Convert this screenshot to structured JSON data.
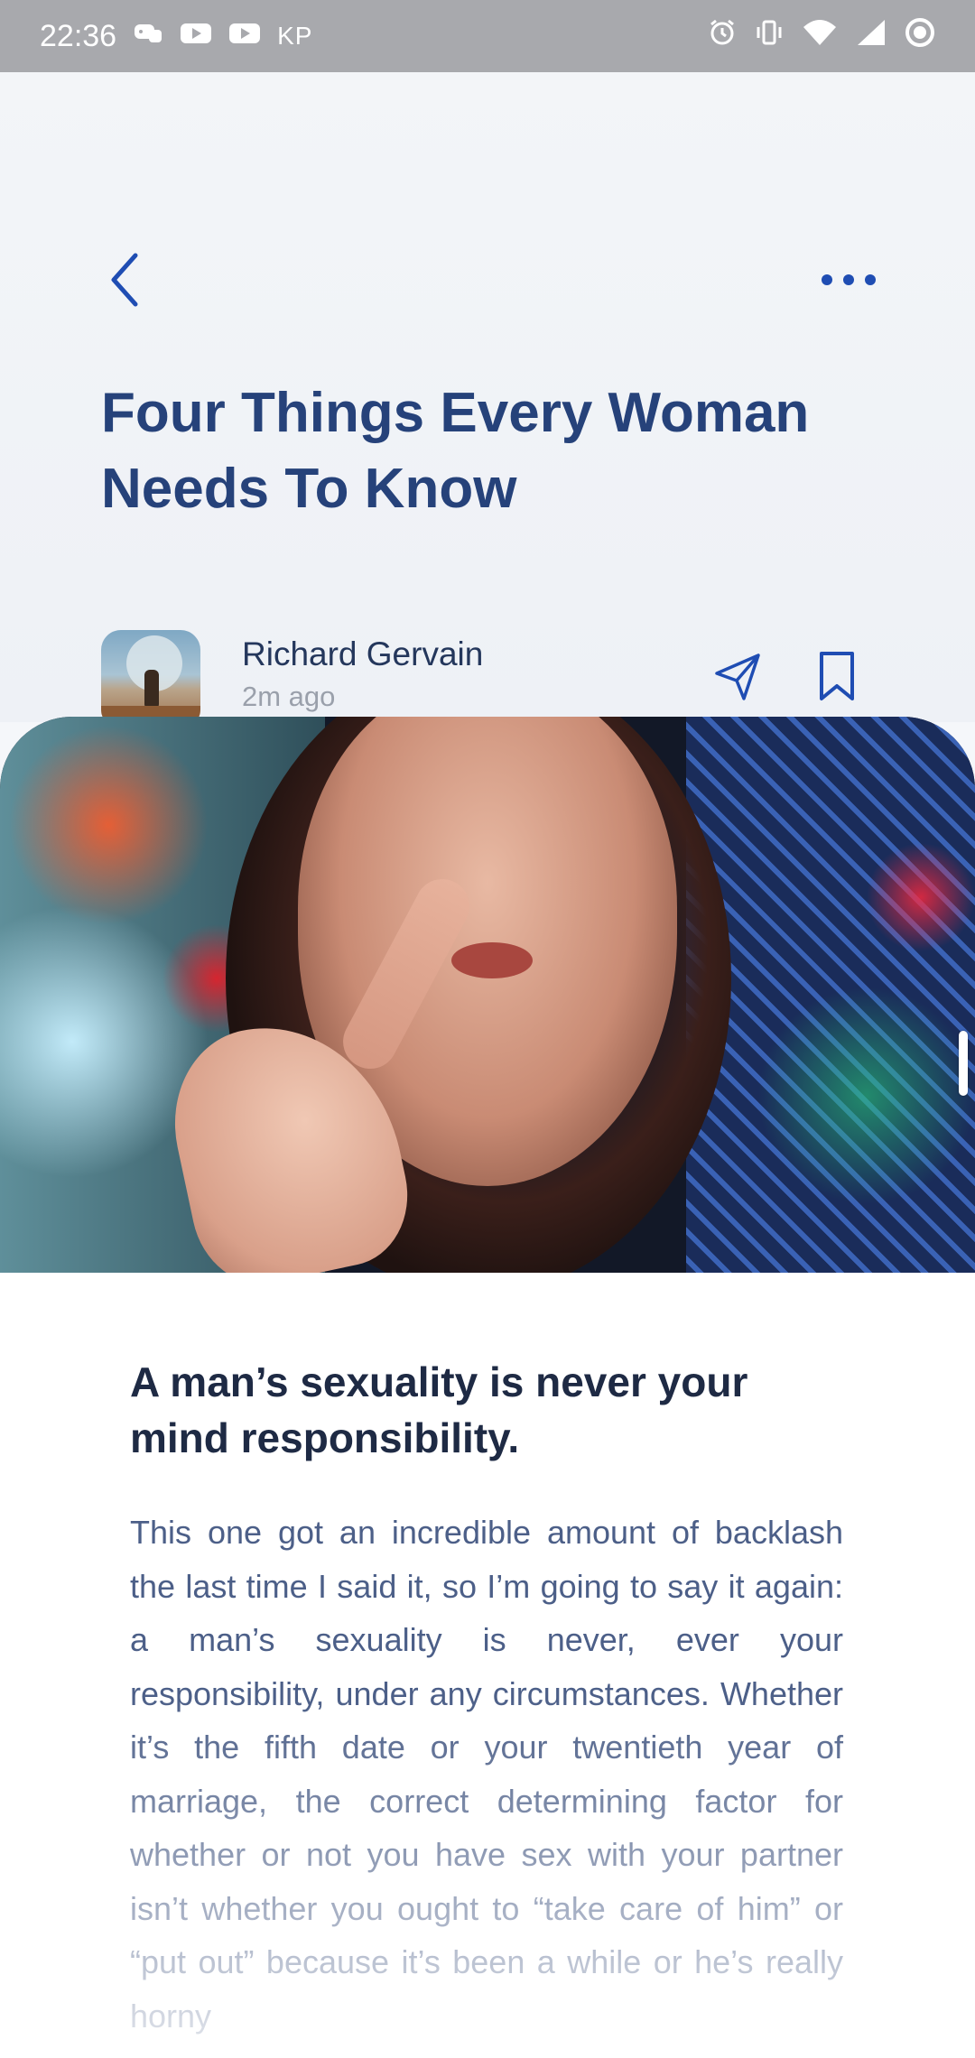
{
  "status_bar": {
    "time": "22:36",
    "carrier": "KP",
    "left_icons": [
      "game-controller-icon",
      "youtube-icon",
      "youtube-icon"
    ],
    "right_icons": [
      "alarm-icon",
      "vibrate-icon",
      "wifi-icon",
      "signal-icon",
      "record-icon"
    ]
  },
  "header": {
    "back_icon": "chevron-left-icon",
    "more_icon": "more-horizontal-icon"
  },
  "article": {
    "title": "Four Things Every Woman Needs To Know",
    "author": {
      "name": "Richard Gervain",
      "time": "2m ago"
    },
    "actions": {
      "share_icon": "send-icon",
      "bookmark_icon": "bookmark-icon"
    },
    "heading": "A man’s sexuality is never your mind responsibility.",
    "body": "This one got an incredible amount of backlash the last time I said it, so I’m going to say it again: a man’s sexuality is never, ever your responsibility, under any circumstances. Whether it’s the fifth date or your twentieth year of marriage, the correct determining factor for whether or not you have sex with your partner isn’t whether you ought to “take care of him” or “put out” because it’s been a while or he’s really horny"
  },
  "colors": {
    "accent": "#1f4db3",
    "title": "#26427a",
    "status_bar": "#a8a9ad"
  }
}
